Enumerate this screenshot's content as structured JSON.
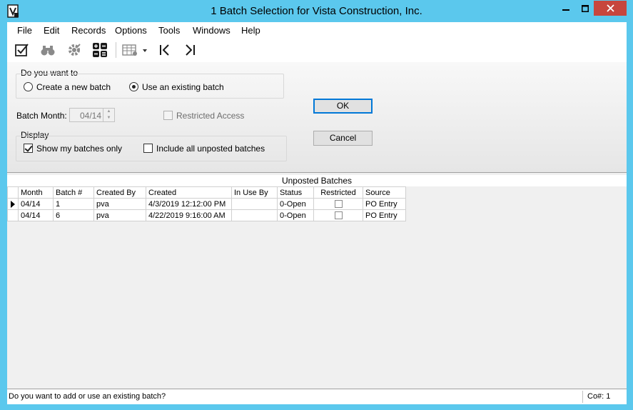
{
  "window": {
    "title": "1 Batch Selection for Vista Construction, Inc.",
    "app_icon": "vista-app-icon",
    "buttons": {
      "minimize": "minimize-icon",
      "maximize": "maximize-icon",
      "close": "close-icon"
    },
    "accent_color": "#5bc8ed"
  },
  "menu": {
    "items": [
      "File",
      "Edit",
      "Records",
      "Options",
      "Tools",
      "Windows",
      "Help"
    ]
  },
  "toolbar": {
    "icons": [
      "check-edit-icon",
      "binoculars-icon",
      "gear-icon",
      "calculator-icon",
      "grid-options-icon",
      "first-record-icon",
      "last-record-icon"
    ]
  },
  "form": {
    "do_you_want": {
      "label": "Do you want to",
      "create_new_label": "Create a new batch",
      "create_new_selected": false,
      "use_existing_label": "Use an existing batch",
      "use_existing_selected": true
    },
    "batch_month_label": "Batch Month:",
    "batch_month_value": "04/14",
    "restricted_access_label": "Restricted Access",
    "restricted_access_checked": false,
    "display": {
      "label": "Display",
      "show_my_batches_label": "Show my batches only",
      "show_my_batches_checked": true,
      "include_unposted_label": "Include all unposted batches",
      "include_unposted_checked": false
    },
    "ok_label": "OK",
    "cancel_label": "Cancel"
  },
  "grid": {
    "caption": "Unposted Batches",
    "columns": [
      "Month",
      "Batch #",
      "Created By",
      "Created",
      "In Use By",
      "Status",
      "Restricted",
      "Source"
    ],
    "rows": [
      {
        "month": "04/14",
        "batch": "1",
        "created_by": "pva",
        "created": "4/3/2019 12:12:00 PM",
        "in_use_by": "",
        "status": "0-Open",
        "restricted": false,
        "source": "PO Entry",
        "current": true
      },
      {
        "month": "04/14",
        "batch": "6",
        "created_by": "pva",
        "created": "4/22/2019 9:16:00 AM",
        "in_use_by": "",
        "status": "0-Open",
        "restricted": false,
        "source": "PO Entry",
        "current": false
      }
    ]
  },
  "status": {
    "message": "Do you want to add or use an existing batch?",
    "company": "Co#: 1"
  }
}
